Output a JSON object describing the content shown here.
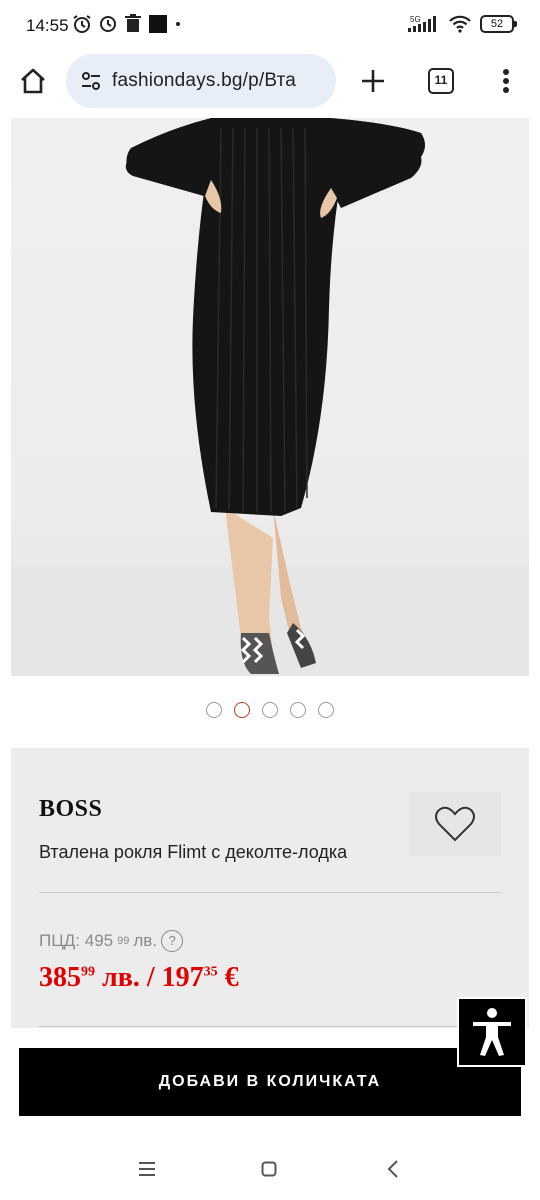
{
  "status": {
    "time": "14:55",
    "network": "5G",
    "battery": "52"
  },
  "browser": {
    "url": "fashiondays.bg/p/Вта",
    "tab_count": "11"
  },
  "gallery": {
    "image_count": 5,
    "active_index": 1
  },
  "product": {
    "brand": "BOSS",
    "name": "Вталена рокля Flimt с деколте-лодка",
    "old_price_label": "ПЦД: 495",
    "old_price_cents": "99",
    "old_price_currency": " лв.",
    "help_symbol": "?",
    "price_bgn_main": "385",
    "price_bgn_cents": "99",
    "price_bgn_suffix": " лв. / ",
    "price_eur_main": "197",
    "price_eur_cents": "35",
    "price_eur_suffix": " €"
  },
  "actions": {
    "add_to_cart": "ДОБАВИ В КОЛИЧКАТА"
  },
  "colors": {
    "price_red": "#e00000",
    "button_black": "#000000",
    "active_dot": "#c0392b"
  }
}
